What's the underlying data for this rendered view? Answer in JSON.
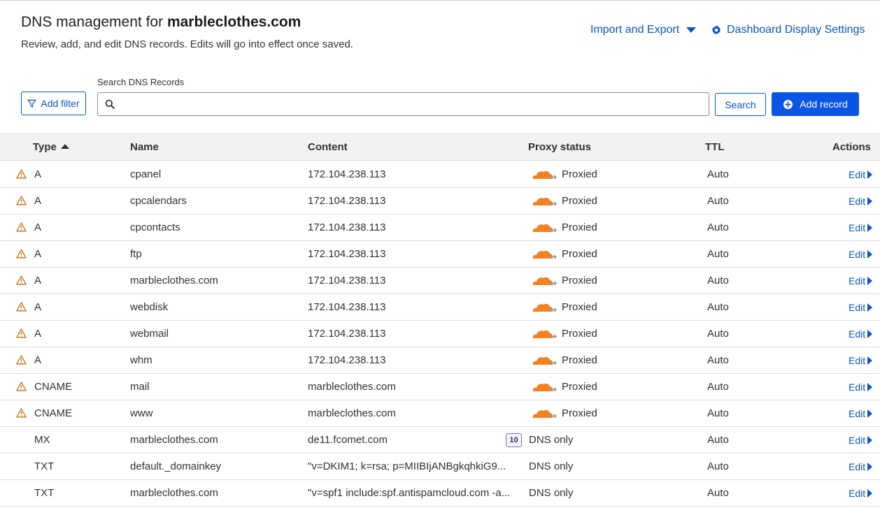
{
  "header": {
    "title_prefix": "DNS management for",
    "domain": "marbleclothes.com",
    "subtitle": "Review, add, and edit DNS records. Edits will go into effect once saved.",
    "import_export_label": "Import and Export",
    "dashboard_settings_label": "Dashboard Display Settings"
  },
  "toolbar": {
    "search_label": "Search DNS Records",
    "search_value": "",
    "add_filter_label": "Add filter",
    "search_button_label": "Search",
    "add_record_label": "Add record"
  },
  "table": {
    "columns": {
      "type": "Type",
      "name": "Name",
      "content": "Content",
      "proxy": "Proxy status",
      "ttl": "TTL",
      "actions": "Actions"
    },
    "edit_label": "Edit",
    "rows": [
      {
        "warning": true,
        "type": "A",
        "name": "cpanel",
        "content": "172.104.238.113",
        "proxy": "Proxied",
        "proxied": true,
        "ttl": "Auto"
      },
      {
        "warning": true,
        "type": "A",
        "name": "cpcalendars",
        "content": "172.104.238.113",
        "proxy": "Proxied",
        "proxied": true,
        "ttl": "Auto"
      },
      {
        "warning": true,
        "type": "A",
        "name": "cpcontacts",
        "content": "172.104.238.113",
        "proxy": "Proxied",
        "proxied": true,
        "ttl": "Auto"
      },
      {
        "warning": true,
        "type": "A",
        "name": "ftp",
        "content": "172.104.238.113",
        "proxy": "Proxied",
        "proxied": true,
        "ttl": "Auto"
      },
      {
        "warning": true,
        "type": "A",
        "name": "marbleclothes.com",
        "content": "172.104.238.113",
        "proxy": "Proxied",
        "proxied": true,
        "ttl": "Auto"
      },
      {
        "warning": true,
        "type": "A",
        "name": "webdisk",
        "content": "172.104.238.113",
        "proxy": "Proxied",
        "proxied": true,
        "ttl": "Auto"
      },
      {
        "warning": true,
        "type": "A",
        "name": "webmail",
        "content": "172.104.238.113",
        "proxy": "Proxied",
        "proxied": true,
        "ttl": "Auto"
      },
      {
        "warning": true,
        "type": "A",
        "name": "whm",
        "content": "172.104.238.113",
        "proxy": "Proxied",
        "proxied": true,
        "ttl": "Auto"
      },
      {
        "warning": true,
        "type": "CNAME",
        "name": "mail",
        "content": "marbleclothes.com",
        "proxy": "Proxied",
        "proxied": true,
        "ttl": "Auto"
      },
      {
        "warning": true,
        "type": "CNAME",
        "name": "www",
        "content": "marbleclothes.com",
        "proxy": "Proxied",
        "proxied": true,
        "ttl": "Auto"
      },
      {
        "warning": false,
        "type": "MX",
        "name": "marbleclothes.com",
        "content": "de11.fcomet.com",
        "priority": "10",
        "proxy": "DNS only",
        "proxied": false,
        "ttl": "Auto"
      },
      {
        "warning": false,
        "type": "TXT",
        "name": "default._domainkey",
        "content": "\"v=DKIM1; k=rsa; p=MIIBIjANBgkqhkiG9...",
        "proxy": "DNS only",
        "proxied": false,
        "ttl": "Auto"
      },
      {
        "warning": false,
        "type": "TXT",
        "name": "marbleclothes.com",
        "content": "\"v=spf1 include:spf.antispamcloud.com -a...",
        "proxy": "DNS only",
        "proxied": false,
        "ttl": "Auto"
      }
    ]
  },
  "colors": {
    "accent": "#0b55c4",
    "primary_button": "#0b55e6",
    "warning": "#c77b2a",
    "cloud": "#f48120"
  }
}
